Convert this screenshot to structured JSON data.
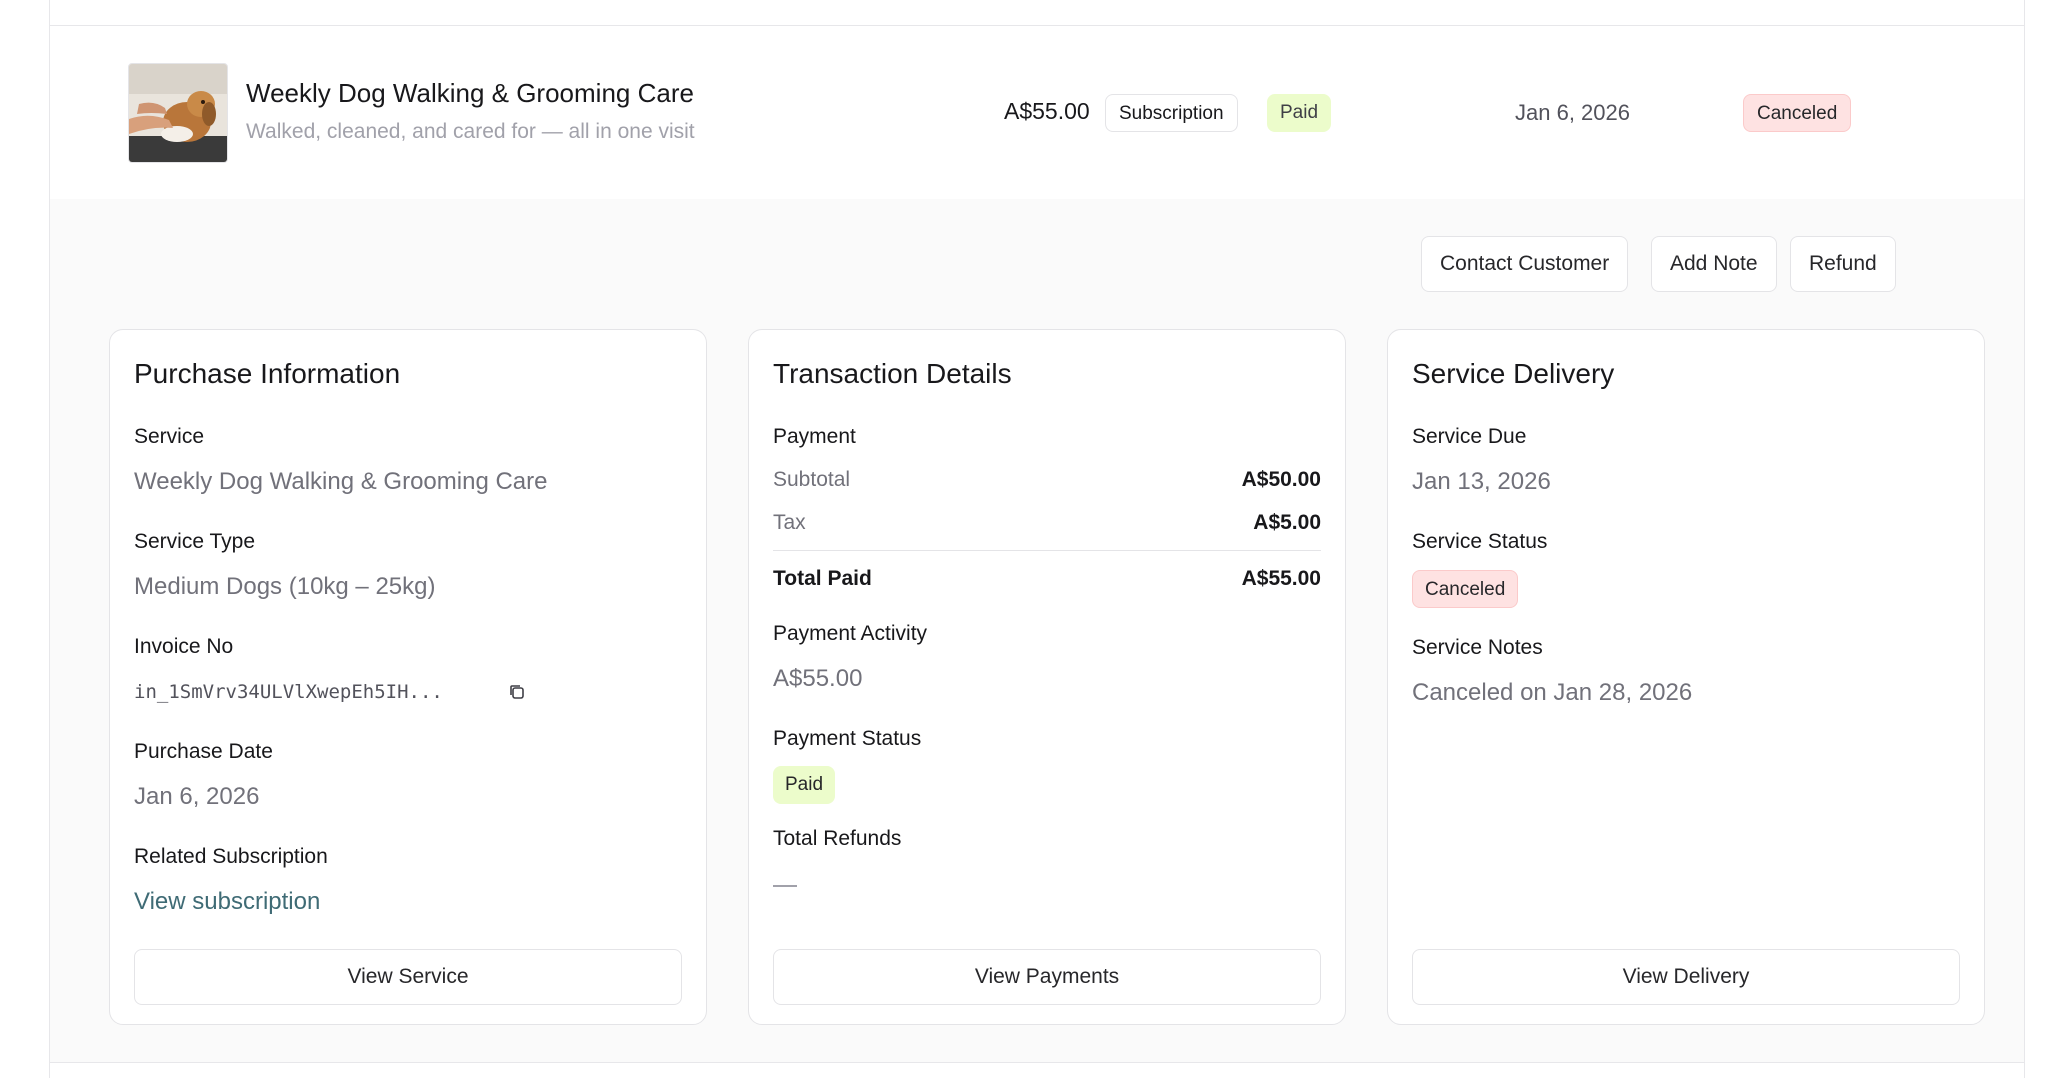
{
  "row": {
    "title": "Weekly Dog Walking & Grooming Care",
    "subtitle": "Walked, cleaned, and cared for — all in one visit",
    "price": "A$55.00",
    "billing_type": "Subscription",
    "payment_status": "Paid",
    "date": "Jan 6, 2026",
    "service_status": "Canceled"
  },
  "actions": {
    "contact": "Contact Customer",
    "note": "Add Note",
    "refund": "Refund"
  },
  "purchase": {
    "title": "Purchase Information",
    "service_label": "Service",
    "service_value": "Weekly Dog Walking & Grooming Care",
    "type_label": "Service Type",
    "type_value": "Medium Dogs (10kg – 25kg)",
    "invoice_label": "Invoice No",
    "invoice_value": "in_1SmVrv34ULVlXwepEh5IH...",
    "date_label": "Purchase Date",
    "date_value": "Jan 6, 2026",
    "subscription_label": "Related Subscription",
    "subscription_link": "View subscription",
    "button": "View Service"
  },
  "transaction": {
    "title": "Transaction Details",
    "payment_label": "Payment",
    "subtotal_label": "Subtotal",
    "subtotal_value": "A$50.00",
    "tax_label": "Tax",
    "tax_value": "A$5.00",
    "total_label": "Total Paid",
    "total_value": "A$55.00",
    "activity_label": "Payment Activity",
    "activity_value": "A$55.00",
    "status_label": "Payment Status",
    "status_value": "Paid",
    "refunds_label": "Total Refunds",
    "button": "View Payments"
  },
  "delivery": {
    "title": "Service Delivery",
    "due_label": "Service Due",
    "due_value": "Jan 13, 2026",
    "status_label": "Service Status",
    "status_value": "Canceled",
    "notes_label": "Service Notes",
    "notes_value": "Canceled on Jan 28, 2026",
    "button": "View Delivery"
  },
  "colors": {
    "paid_badge_bg": "#ecfccb",
    "canceled_badge_bg": "#fee2e2",
    "link": "#3f6b75",
    "panel_bg": "#fafafa"
  }
}
